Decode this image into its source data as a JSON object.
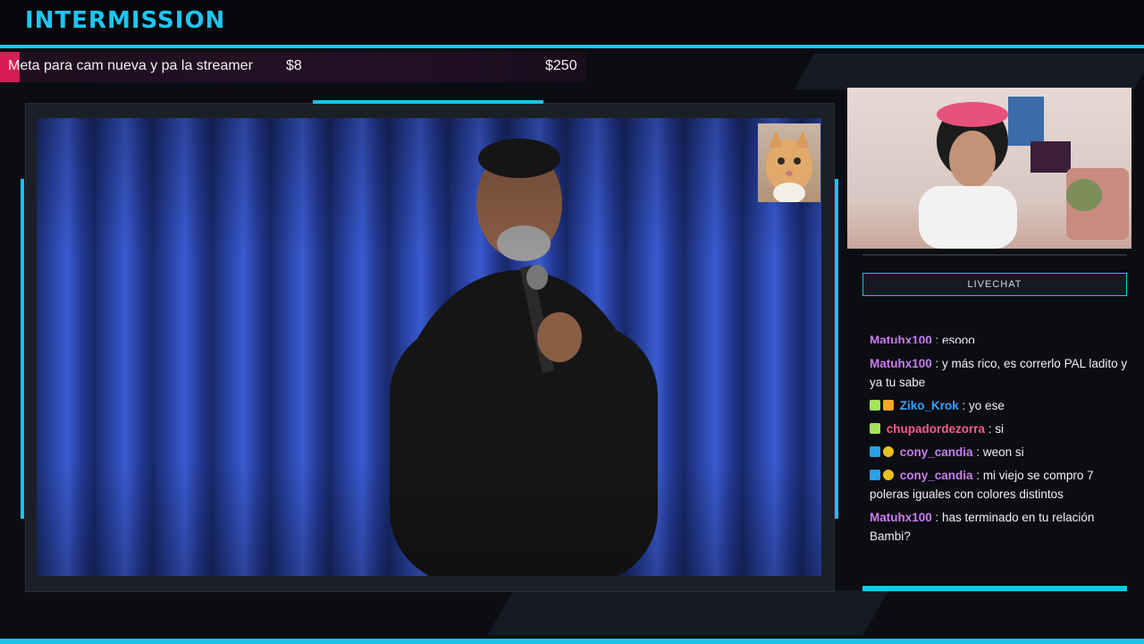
{
  "header": {
    "title": "INTERMISSION"
  },
  "goal": {
    "label": "Meta para cam nueva y pa la streamer",
    "current": "$8",
    "target": "$250",
    "progress_fraction": 0.032
  },
  "colors": {
    "accent": "#19c3ea",
    "goal_fill": "#d51c54",
    "purple_user": "#c97cf0",
    "blue_user": "#3aa0ff",
    "pink_user": "#ff5a8a"
  },
  "chat": {
    "header": "LIVECHAT",
    "messages": [
      {
        "user": "Matuhx100",
        "text": " : esooo",
        "color": "purple",
        "badges": []
      },
      {
        "user": "Matuhx100",
        "text": " : y más rico, es correrlo PAL ladito y ya tu sabe",
        "color": "purple",
        "badges": []
      },
      {
        "user": "Ziko_Krok",
        "text": " : yo ese",
        "color": "blue",
        "badges": [
          "cat",
          "crown"
        ]
      },
      {
        "user": "chupadordezorra",
        "text": " : si",
        "color": "pink",
        "badges": [
          "cat"
        ]
      },
      {
        "user": "cony_candia",
        "text": " : weon si",
        "color": "purple",
        "badges": [
          "star",
          "coin"
        ]
      },
      {
        "user": "cony_candia",
        "text": " : mi viejo se compro 7 poleras iguales con colores distintos",
        "color": "purple",
        "badges": [
          "star",
          "coin"
        ]
      },
      {
        "user": "Matuhx100",
        "text": " : has terminado en tu relación Bambi?",
        "color": "purple",
        "badges": []
      }
    ]
  }
}
